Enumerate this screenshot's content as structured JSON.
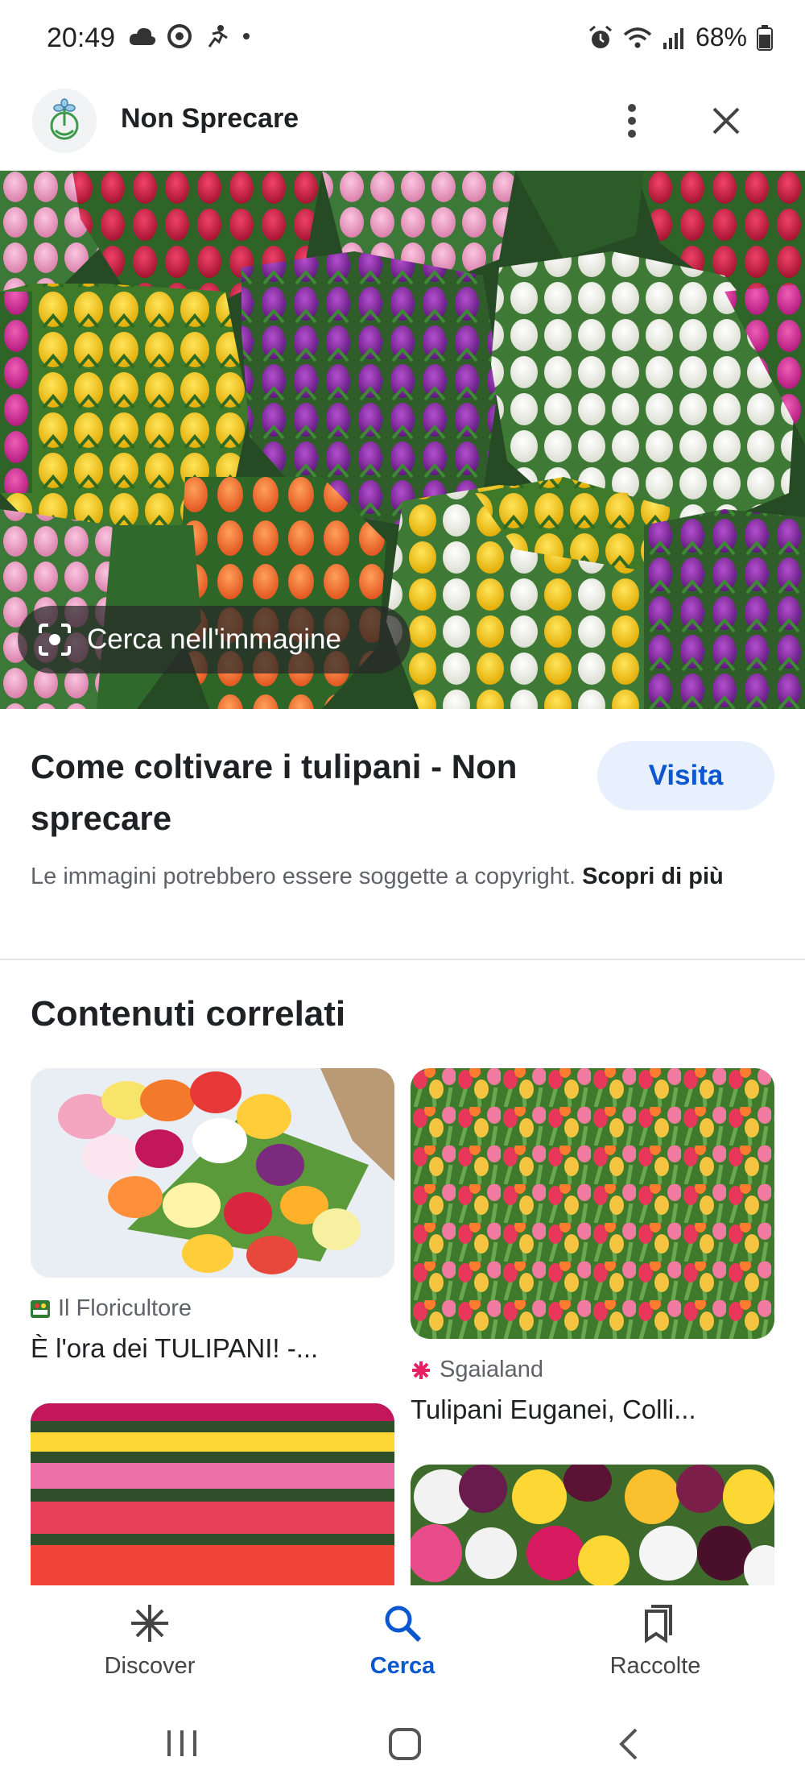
{
  "status_bar": {
    "time": "20:49",
    "battery": "68%",
    "left_icons": [
      "cloud-icon",
      "chrome-icon",
      "runner-icon",
      "dot-icon"
    ],
    "right_icons": [
      "alarm-icon",
      "wifi-icon",
      "signal-icon",
      "battery-icon"
    ]
  },
  "header": {
    "site_name": "Non Sprecare",
    "logo_icon": "plant-hand-logo",
    "more_icon": "more-vert-icon",
    "close_icon": "close-icon"
  },
  "hero": {
    "lens_label": "Cerca nell'immagine",
    "lens_icon": "lens-icon"
  },
  "result": {
    "title": "Come coltivare i tulipani - Non sprecare",
    "visit_label": "Visita",
    "copyright_text": "Le immagini potrebbero essere soggette a copyright.",
    "copyright_link": "Scopri di più"
  },
  "related": {
    "heading": "Contenuti correlati",
    "cards": [
      {
        "source": "Il Floricultore",
        "caption": "È l'ora dei TULIPANI! -..."
      },
      {
        "source": "Sgaialand",
        "caption": "Tulipani Euganei, Colli..."
      }
    ]
  },
  "bottom_nav": {
    "items": [
      {
        "label": "Discover",
        "icon": "asterisk-icon"
      },
      {
        "label": "Cerca",
        "icon": "search-icon",
        "active": true
      },
      {
        "label": "Raccolte",
        "icon": "bookmarks-icon"
      }
    ]
  },
  "system_nav": [
    "recents-icon",
    "home-icon",
    "back-icon"
  ],
  "colors": {
    "accent": "#0b57d0",
    "visit_bg": "#e8f0fe"
  }
}
